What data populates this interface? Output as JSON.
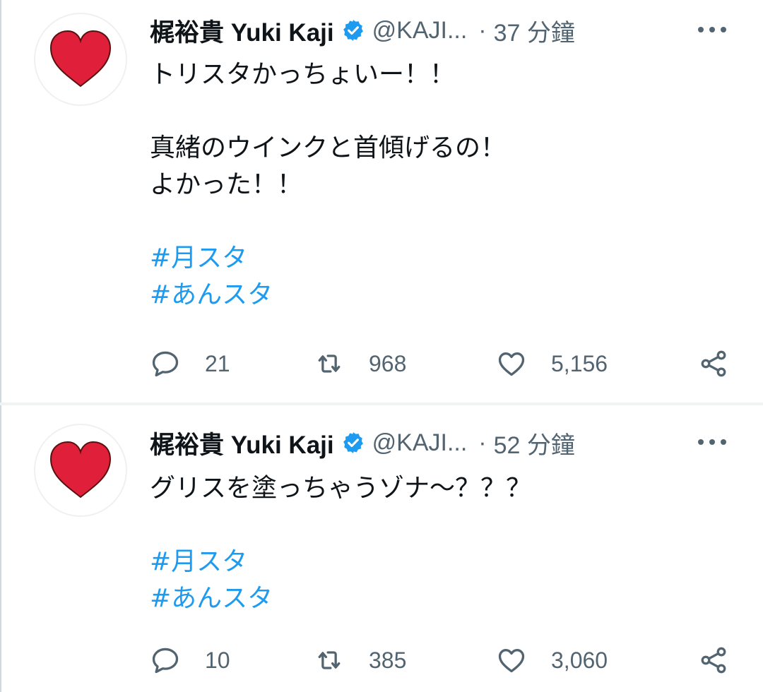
{
  "tweets": [
    {
      "display_name": "梶裕貴 Yuki Kaji",
      "handle": "@KAJI...",
      "separator": "·",
      "time": "37 分鐘",
      "lines": [
        "トリスタかっちょいー！！",
        "",
        "真緒のウインクと首傾げるの！",
        "よかった！！",
        ""
      ],
      "hashtags": [
        "#月スタ",
        "#あんスタ"
      ],
      "replies": "21",
      "retweets": "968",
      "likes": "5,156"
    },
    {
      "display_name": "梶裕貴 Yuki Kaji",
      "handle": "@KAJI...",
      "separator": "·",
      "time": "52 分鐘",
      "lines": [
        "グリスを塗っちゃうゾナ〜？？？",
        ""
      ],
      "hashtags": [
        "#月スタ",
        "#あんスタ"
      ],
      "replies": "10",
      "retweets": "385",
      "likes": "3,060"
    }
  ],
  "colors": {
    "accent": "#1d9bf0",
    "heart": "#e0203a",
    "muted": "#536471"
  },
  "icons": [
    "heart-avatar-icon",
    "verified-badge-icon",
    "more-icon",
    "reply-icon",
    "retweet-icon",
    "like-icon",
    "share-icon"
  ]
}
